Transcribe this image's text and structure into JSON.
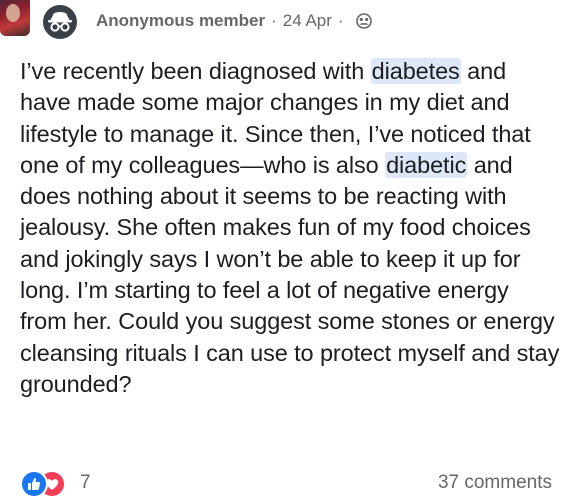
{
  "post": {
    "author": "Anonymous member",
    "date": "24 Apr",
    "separator": "·",
    "visibility_icon": "group-icon",
    "avatar_icon": "anonymous-incognito-icon",
    "body": {
      "part1": "I’ve recently been diagnosed with ",
      "highlight1": "diabetes",
      "part2": " and have made some major changes in my diet and lifestyle to manage it. Since then, I’ve noticed that one of my colleagues—who is also ",
      "highlight2": "diabetic",
      "part3": " and does nothing about it seems to be reacting with jealousy. She often makes fun of my food choices and jokingly says I won’t be able to keep it up for long. I’m starting to feel a lot of negative energy from her. Could you suggest some stones or energy cleansing rituals I can use to protect myself and stay grounded?"
    },
    "highlight_color": "#dde7f8"
  },
  "footer": {
    "reaction_icons": [
      "like-icon",
      "love-icon"
    ],
    "reaction_count": "7",
    "comments": "37 comments"
  },
  "colors": {
    "like": "#1877f2",
    "love": "#f33e58",
    "meta_text": "#65676b",
    "body_text": "#1c1e21"
  }
}
